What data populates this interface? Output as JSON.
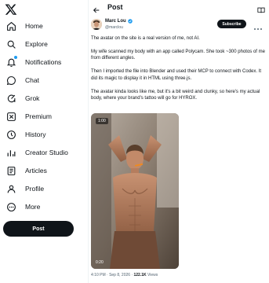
{
  "sidebar": {
    "logo_icon": "x-logo-icon",
    "items": [
      {
        "label": "Home",
        "icon": "home-icon"
      },
      {
        "label": "Explore",
        "icon": "search-icon"
      },
      {
        "label": "Notifications",
        "icon": "bell-icon"
      },
      {
        "label": "Chat",
        "icon": "chat-icon"
      },
      {
        "label": "Grok",
        "icon": "grok-icon"
      },
      {
        "label": "Premium",
        "icon": "x-premium-icon"
      },
      {
        "label": "History",
        "icon": "history-icon"
      },
      {
        "label": "Creator Studio",
        "icon": "creator-studio-icon"
      },
      {
        "label": "Articles",
        "icon": "articles-icon"
      },
      {
        "label": "Profile",
        "icon": "profile-icon"
      },
      {
        "label": "More",
        "icon": "more-icon"
      }
    ],
    "post_button": "Post"
  },
  "header": {
    "title": "Post"
  },
  "post": {
    "author_name": "Marc Lou",
    "author_handle": "@marclou",
    "subscribe_label": "Subscribe",
    "paragraphs": [
      "The avatar on the site is a real version of me, not AI.",
      "My wife scanned my body with an app called Polycam. She took ~300 photos of me from different angles.",
      "Then I imported the file into Blender and used their MCP to connect with Codex. It did its magic to display it in HTML using three.js.",
      "The avatar kinda looks like me, but it's a bit weird and clunky, so here's my actual body, where your brand's tattoo will go for HYROX."
    ],
    "video_duration_badge": "1:00",
    "video_time": "0:20",
    "meta_time": "4:10 PM · Sep 8, 2026 · ",
    "meta_views_count": "122.1K",
    "meta_views_label": " Views"
  },
  "colors": {
    "accent": "#1d9bf0",
    "text": "#0f1419",
    "muted": "#536471",
    "button_dark": "#0f1419"
  }
}
